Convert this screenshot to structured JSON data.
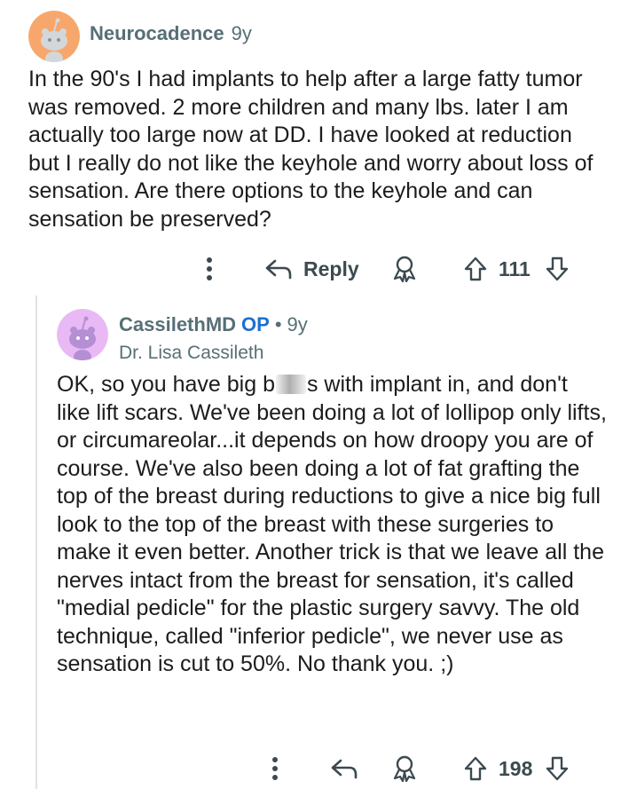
{
  "parent": {
    "author": "Neurocadence",
    "age": "9y",
    "text": "In the 90's I had implants to help after a large fatty tumor was removed. 2 more children and many lbs. later I am actually too large now at DD. I have looked at reduction but I really do not like the keyhole and worry about loss of sensation. Are there options to the keyhole and can sensation be preserved?",
    "reply_label": "Reply",
    "score": "111",
    "avatar_color": "#f7a76b"
  },
  "reply": {
    "author": "CassilethMD",
    "op_badge": "OP",
    "separator": "•",
    "age": "9y",
    "flair": "Dr. Lisa Cassileth",
    "text_before": "OK, so you have big b",
    "text_after": "s with implant in, and don't like lift scars. We've been doing a lot of lollipop only lifts, or circumareolar...it depends on how droopy you are of course. We've also been doing a lot of fat grafting the top of the breast during reductions to give a nice big full look to the top of the breast with these surgeries to make it even better. Another trick is that we leave all the nerves intact from the breast for sensation, it's called \"medial pedicle\" for the plastic surgery savvy. The old technique, called \"inferior pedicle\", we never use as sensation is cut to 50%. No thank you. ;)",
    "score": "198",
    "avatar_color": "#e9b9f5"
  },
  "icons": {
    "more": "more-options-icon",
    "reply": "reply-arrow-icon",
    "award": "award-icon",
    "upvote": "upvote-icon",
    "downvote": "downvote-icon"
  }
}
